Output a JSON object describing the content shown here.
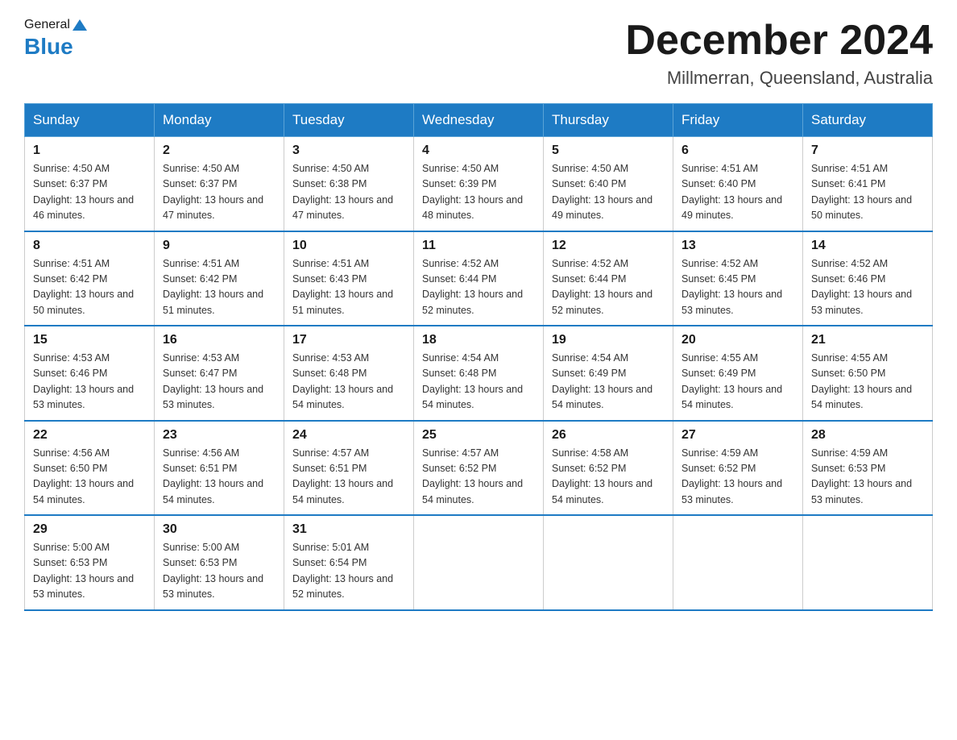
{
  "header": {
    "logo_general": "General",
    "logo_blue": "Blue",
    "month_title": "December 2024",
    "location": "Millmerran, Queensland, Australia"
  },
  "weekdays": [
    "Sunday",
    "Monday",
    "Tuesday",
    "Wednesday",
    "Thursday",
    "Friday",
    "Saturday"
  ],
  "weeks": [
    [
      {
        "day": "1",
        "sunrise": "4:50 AM",
        "sunset": "6:37 PM",
        "daylight": "13 hours and 46 minutes."
      },
      {
        "day": "2",
        "sunrise": "4:50 AM",
        "sunset": "6:37 PM",
        "daylight": "13 hours and 47 minutes."
      },
      {
        "day": "3",
        "sunrise": "4:50 AM",
        "sunset": "6:38 PM",
        "daylight": "13 hours and 47 minutes."
      },
      {
        "day": "4",
        "sunrise": "4:50 AM",
        "sunset": "6:39 PM",
        "daylight": "13 hours and 48 minutes."
      },
      {
        "day": "5",
        "sunrise": "4:50 AM",
        "sunset": "6:40 PM",
        "daylight": "13 hours and 49 minutes."
      },
      {
        "day": "6",
        "sunrise": "4:51 AM",
        "sunset": "6:40 PM",
        "daylight": "13 hours and 49 minutes."
      },
      {
        "day": "7",
        "sunrise": "4:51 AM",
        "sunset": "6:41 PM",
        "daylight": "13 hours and 50 minutes."
      }
    ],
    [
      {
        "day": "8",
        "sunrise": "4:51 AM",
        "sunset": "6:42 PM",
        "daylight": "13 hours and 50 minutes."
      },
      {
        "day": "9",
        "sunrise": "4:51 AM",
        "sunset": "6:42 PM",
        "daylight": "13 hours and 51 minutes."
      },
      {
        "day": "10",
        "sunrise": "4:51 AM",
        "sunset": "6:43 PM",
        "daylight": "13 hours and 51 minutes."
      },
      {
        "day": "11",
        "sunrise": "4:52 AM",
        "sunset": "6:44 PM",
        "daylight": "13 hours and 52 minutes."
      },
      {
        "day": "12",
        "sunrise": "4:52 AM",
        "sunset": "6:44 PM",
        "daylight": "13 hours and 52 minutes."
      },
      {
        "day": "13",
        "sunrise": "4:52 AM",
        "sunset": "6:45 PM",
        "daylight": "13 hours and 53 minutes."
      },
      {
        "day": "14",
        "sunrise": "4:52 AM",
        "sunset": "6:46 PM",
        "daylight": "13 hours and 53 minutes."
      }
    ],
    [
      {
        "day": "15",
        "sunrise": "4:53 AM",
        "sunset": "6:46 PM",
        "daylight": "13 hours and 53 minutes."
      },
      {
        "day": "16",
        "sunrise": "4:53 AM",
        "sunset": "6:47 PM",
        "daylight": "13 hours and 53 minutes."
      },
      {
        "day": "17",
        "sunrise": "4:53 AM",
        "sunset": "6:48 PM",
        "daylight": "13 hours and 54 minutes."
      },
      {
        "day": "18",
        "sunrise": "4:54 AM",
        "sunset": "6:48 PM",
        "daylight": "13 hours and 54 minutes."
      },
      {
        "day": "19",
        "sunrise": "4:54 AM",
        "sunset": "6:49 PM",
        "daylight": "13 hours and 54 minutes."
      },
      {
        "day": "20",
        "sunrise": "4:55 AM",
        "sunset": "6:49 PM",
        "daylight": "13 hours and 54 minutes."
      },
      {
        "day": "21",
        "sunrise": "4:55 AM",
        "sunset": "6:50 PM",
        "daylight": "13 hours and 54 minutes."
      }
    ],
    [
      {
        "day": "22",
        "sunrise": "4:56 AM",
        "sunset": "6:50 PM",
        "daylight": "13 hours and 54 minutes."
      },
      {
        "day": "23",
        "sunrise": "4:56 AM",
        "sunset": "6:51 PM",
        "daylight": "13 hours and 54 minutes."
      },
      {
        "day": "24",
        "sunrise": "4:57 AM",
        "sunset": "6:51 PM",
        "daylight": "13 hours and 54 minutes."
      },
      {
        "day": "25",
        "sunrise": "4:57 AM",
        "sunset": "6:52 PM",
        "daylight": "13 hours and 54 minutes."
      },
      {
        "day": "26",
        "sunrise": "4:58 AM",
        "sunset": "6:52 PM",
        "daylight": "13 hours and 54 minutes."
      },
      {
        "day": "27",
        "sunrise": "4:59 AM",
        "sunset": "6:52 PM",
        "daylight": "13 hours and 53 minutes."
      },
      {
        "day": "28",
        "sunrise": "4:59 AM",
        "sunset": "6:53 PM",
        "daylight": "13 hours and 53 minutes."
      }
    ],
    [
      {
        "day": "29",
        "sunrise": "5:00 AM",
        "sunset": "6:53 PM",
        "daylight": "13 hours and 53 minutes."
      },
      {
        "day": "30",
        "sunrise": "5:00 AM",
        "sunset": "6:53 PM",
        "daylight": "13 hours and 53 minutes."
      },
      {
        "day": "31",
        "sunrise": "5:01 AM",
        "sunset": "6:54 PM",
        "daylight": "13 hours and 52 minutes."
      },
      null,
      null,
      null,
      null
    ]
  ]
}
